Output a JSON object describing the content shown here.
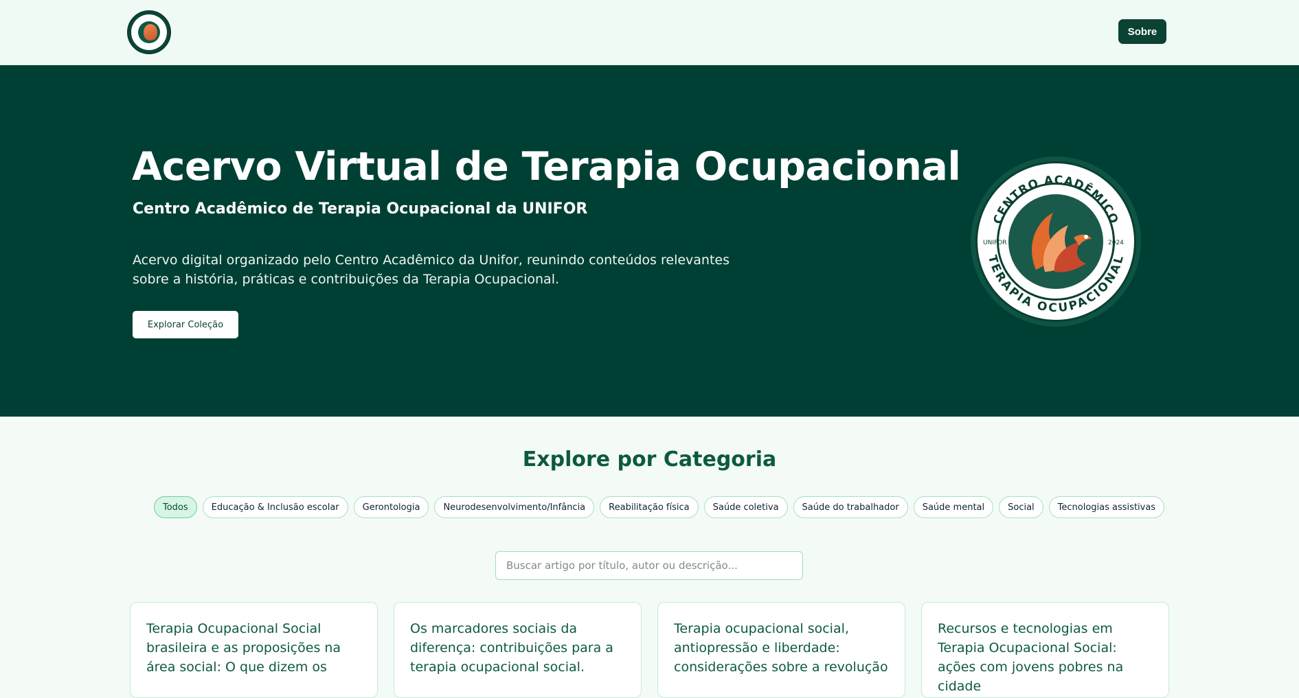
{
  "header": {
    "logo_name": "centro-academico-logo",
    "about_label": "Sobre"
  },
  "hero": {
    "title": "Acervo Virtual de Terapia Ocupacional",
    "subtitle": "Centro Acadêmico de Terapia Ocupacional da UNIFOR",
    "description": "Acervo digital organizado pelo Centro Acadêmico da Unifor, reunindo conteúdos relevantes sobre a história, práticas e contribuições da Terapia Ocupacional.",
    "cta_label": "Explorar Coleção",
    "emblem": {
      "top_text": "CENTRO ACADÊMICO",
      "bottom_text": "TERAPIA OCUPACIONAL",
      "left_text": "UNIFOR",
      "right_text": "2024"
    }
  },
  "categories": {
    "title": "Explore por Categoria",
    "items": [
      {
        "label": "Todos",
        "active": true
      },
      {
        "label": "Educação & Inclusão escolar",
        "active": false
      },
      {
        "label": "Gerontologia",
        "active": false
      },
      {
        "label": "Neurodesenvolvimento/Infância",
        "active": false
      },
      {
        "label": "Reabilitação física",
        "active": false
      },
      {
        "label": "Saúde coletiva",
        "active": false
      },
      {
        "label": "Saúde do trabalhador",
        "active": false
      },
      {
        "label": "Saúde mental",
        "active": false
      },
      {
        "label": "Social",
        "active": false
      },
      {
        "label": "Tecnologias assistivas",
        "active": false
      }
    ]
  },
  "search": {
    "placeholder": "Buscar artigo por título, autor ou descrição...",
    "value": ""
  },
  "cards": [
    {
      "title": "Terapia Ocupacional Social brasileira e as proposições na área social: O que dizem os"
    },
    {
      "title": "Os marcadores sociais da diferença: contribuições para a terapia ocupacional social."
    },
    {
      "title": "Terapia ocupacional social, antiopressão e liberdade: considerações sobre a revolução"
    },
    {
      "title": "Recursos e tecnologias em Terapia Ocupacional Social: ações com jovens pobres na cidade"
    }
  ],
  "colors": {
    "brand_dark": "#004034",
    "accent_green": "#0d5a3e",
    "chip_border": "#a9dfc4",
    "chip_active_bg": "#d7f5e5",
    "flame_orange": "#e8753a"
  }
}
